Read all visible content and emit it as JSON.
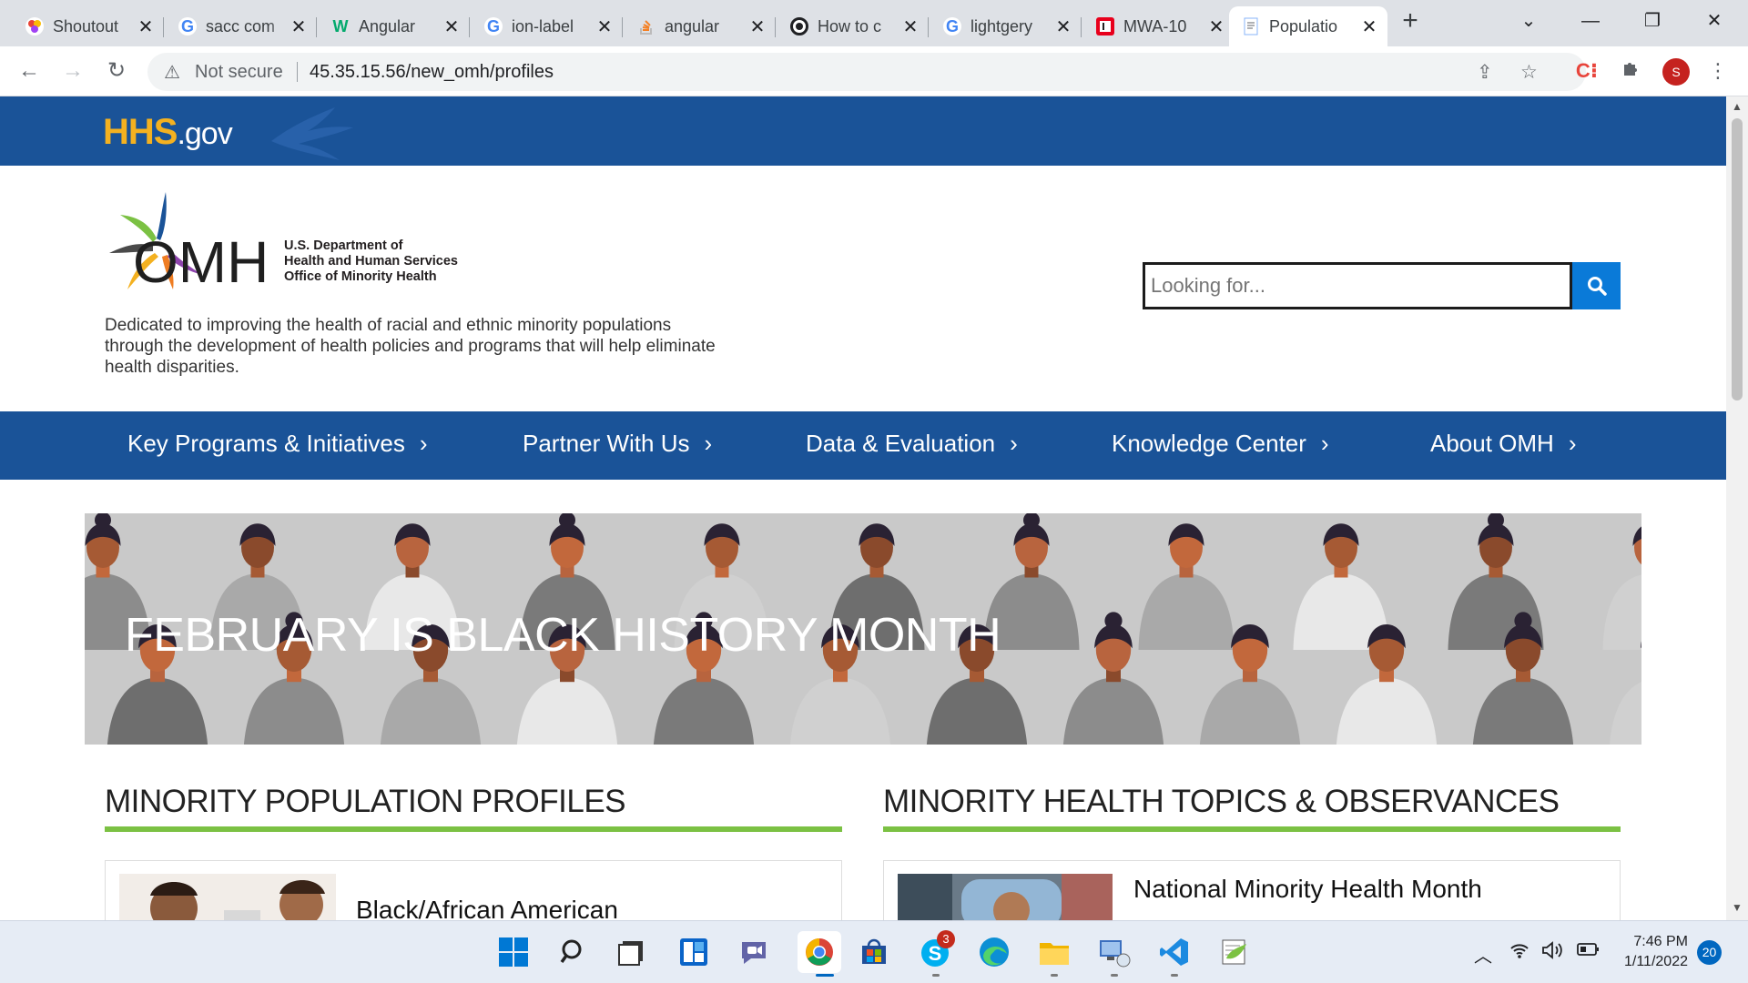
{
  "browser": {
    "tabs": [
      {
        "title": "Shoutout",
        "icon": "shoutout-favicon",
        "active": false
      },
      {
        "title": "sacc com",
        "icon": "google-favicon",
        "active": false
      },
      {
        "title": "Angular",
        "icon": "w3-favicon",
        "active": false
      },
      {
        "title": "ion-label",
        "icon": "google-favicon",
        "active": false
      },
      {
        "title": "angular",
        "icon": "stackoverflow-favicon",
        "active": false
      },
      {
        "title": "How to c",
        "icon": "dev-favicon",
        "active": false
      },
      {
        "title": "lightgery",
        "icon": "google-favicon",
        "active": false
      },
      {
        "title": "MWA-10",
        "icon": "jira-favicon",
        "active": false
      },
      {
        "title": "Populatio",
        "icon": "page-favicon",
        "active": true
      }
    ],
    "security_label": "Not secure",
    "url": "45.35.15.56/new_omh/profiles",
    "profile_initial": "S"
  },
  "page": {
    "hhs_logo_main": "HHS",
    "hhs_logo_suffix": ".gov",
    "omh_logo_text": "OMH",
    "omh_dept_line1": "U.S. Department of",
    "omh_dept_line2": "Health and Human Services",
    "omh_dept_line3": "Office of Minority Health",
    "tagline": "Dedicated to improving the health of racial and ethnic minority populations through the development of health policies and programs that will help eliminate health disparities.",
    "search": {
      "placeholder": "Looking for..."
    },
    "nav": [
      {
        "label": "Key Programs & Initiatives"
      },
      {
        "label": "Partner With Us"
      },
      {
        "label": "Data & Evaluation"
      },
      {
        "label": "Knowledge Center"
      },
      {
        "label": "About OMH"
      }
    ],
    "hero_title": "FEBRUARY IS BLACK HISTORY MONTH",
    "sections": [
      {
        "title": "MINORITY POPULATION PROFILES",
        "card_title": "Black/African American"
      },
      {
        "title": "MINORITY HEALTH TOPICS & OBSERVANCES",
        "card_title": "National Minority Health Month"
      }
    ]
  },
  "taskbar": {
    "apps": [
      "windows-start",
      "search",
      "task-view",
      "widgets",
      "teams-chat",
      "chrome",
      "microsoft-store",
      "skype",
      "edge",
      "file-explorer",
      "remote-desktop",
      "vscode",
      "notepad-plus"
    ],
    "skype_badge": "3",
    "time": "7:46 PM",
    "date": "1/11/2022",
    "notifications": "20"
  },
  "colors": {
    "hhs_blue": "#1a5398",
    "hhs_gold": "#f4b120",
    "accent_green": "#7bc143",
    "search_blue": "#0a7ad8"
  }
}
